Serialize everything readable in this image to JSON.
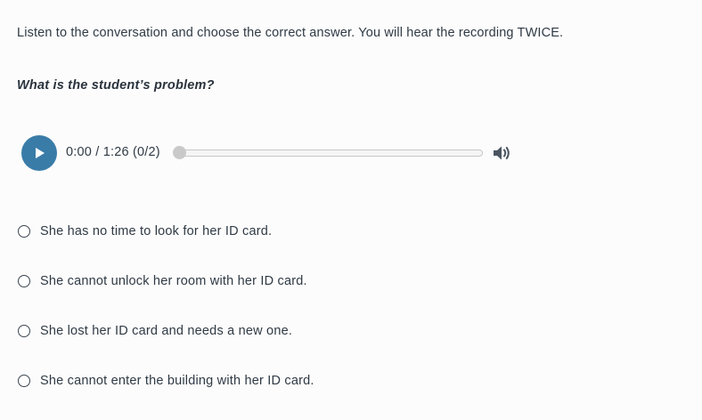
{
  "instructions": "Listen to the conversation and choose the correct answer. You will hear the recording TWICE.",
  "question": "What is the student’s problem?",
  "player": {
    "time_display": "0:00 / 1:26 (0/2)",
    "progress_fraction": 0,
    "play_icon": "play-icon",
    "volume_icon": "volume-icon"
  },
  "options": [
    {
      "label": "She has no time to look for her ID card."
    },
    {
      "label": "She cannot unlock her room with her ID card."
    },
    {
      "label": "She lost her ID card and needs a new one."
    },
    {
      "label": "She cannot enter the building with her ID card."
    }
  ],
  "colors": {
    "accent": "#3a7ca8",
    "text": "#2f3a45"
  }
}
